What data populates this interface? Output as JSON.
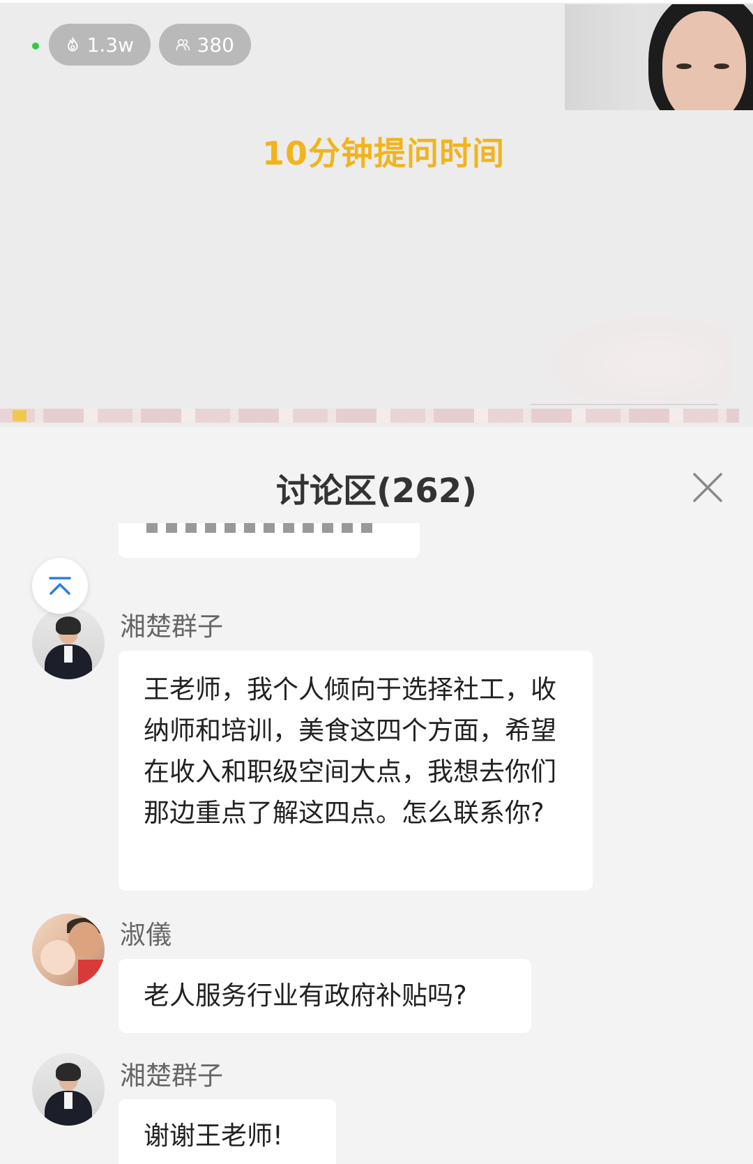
{
  "stream": {
    "heat_count": "1.3w",
    "viewer_count": "380",
    "slide_title": "10分钟提问时间"
  },
  "discussion": {
    "title": "讨论区(262)",
    "messages": [
      {
        "name": "湘楚群子",
        "text": "王老师，我个人倾向于选择社工，收纳师和培训，美食这四个方面，希望在收入和职级空间大点，我想去你们那边重点了解这四点。怎么联系你?"
      },
      {
        "name": "淑儀",
        "text": "老人服务行业有政府补贴吗?"
      },
      {
        "name": "湘楚群子",
        "text": "谢谢王老师!"
      }
    ]
  },
  "colors": {
    "live_indicator": "#2ecc40",
    "slide_title": "#f2b41c",
    "panel_bg": "#f3f3f3",
    "bubble_bg": "#ffffff",
    "accent_blue": "#2a7de1"
  }
}
